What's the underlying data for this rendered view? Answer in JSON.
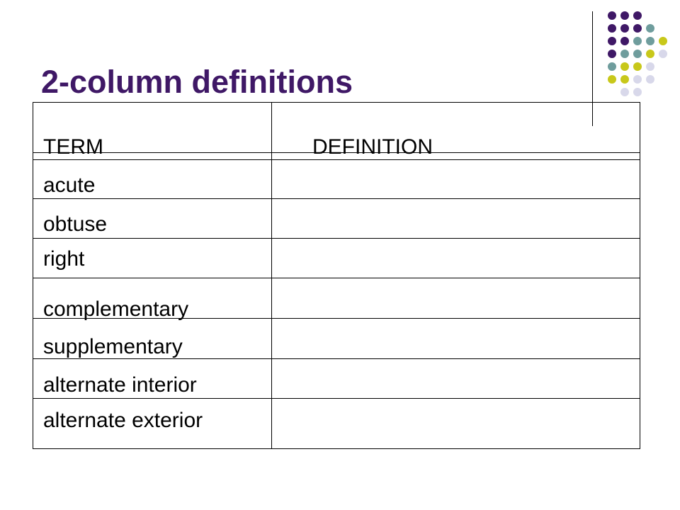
{
  "slide": {
    "title": "2-column definitions"
  },
  "table": {
    "headers": [
      "TERM",
      "DEFINITION"
    ],
    "rows": [
      {
        "term": "acute",
        "definition": ""
      },
      {
        "term": "obtuse",
        "definition": ""
      },
      {
        "term": "right",
        "definition": ""
      },
      {
        "term": "complementary",
        "definition": ""
      },
      {
        "term": "supplementary",
        "definition": ""
      },
      {
        "term": "alternate interior",
        "definition": ""
      },
      {
        "term": "alternate exterior",
        "definition": ""
      }
    ]
  },
  "decoration": {
    "name": "dot-grid-pattern",
    "colors": {
      "purple": "#3f1866",
      "teal": "#6f9d9d",
      "olive": "#c8c81a",
      "lavender": "#d8d8ea"
    }
  }
}
